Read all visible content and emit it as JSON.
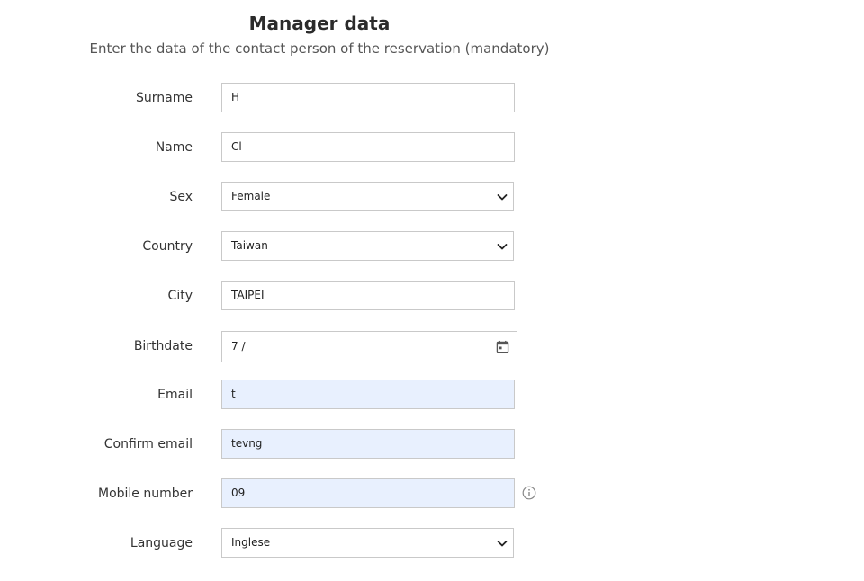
{
  "header": {
    "title": "Manager data",
    "subtitle": "Enter the data of the contact person of the reservation (mandatory)"
  },
  "form": {
    "surname": {
      "label": "Surname",
      "value": "H"
    },
    "name": {
      "label": "Name",
      "value": "Cl"
    },
    "sex": {
      "label": "Sex",
      "value": "Female"
    },
    "country": {
      "label": "Country",
      "value": "Taiwan"
    },
    "city": {
      "label": "City",
      "value": "TAIPEI"
    },
    "birthdate": {
      "label": "Birthdate",
      "value": "7 /"
    },
    "email": {
      "label": "Email",
      "value": "t"
    },
    "confirm_email": {
      "label": "Confirm email",
      "value": "tevng"
    },
    "mobile": {
      "label": "Mobile number",
      "value": "09"
    },
    "language": {
      "label": "Language",
      "value": "Inglese"
    }
  },
  "icons": {
    "select": "chevron-down-icon",
    "date": "calendar-icon",
    "info": "info-icon"
  },
  "colors": {
    "autofill": "#e8f0fe",
    "border": "#c9c9c9"
  }
}
